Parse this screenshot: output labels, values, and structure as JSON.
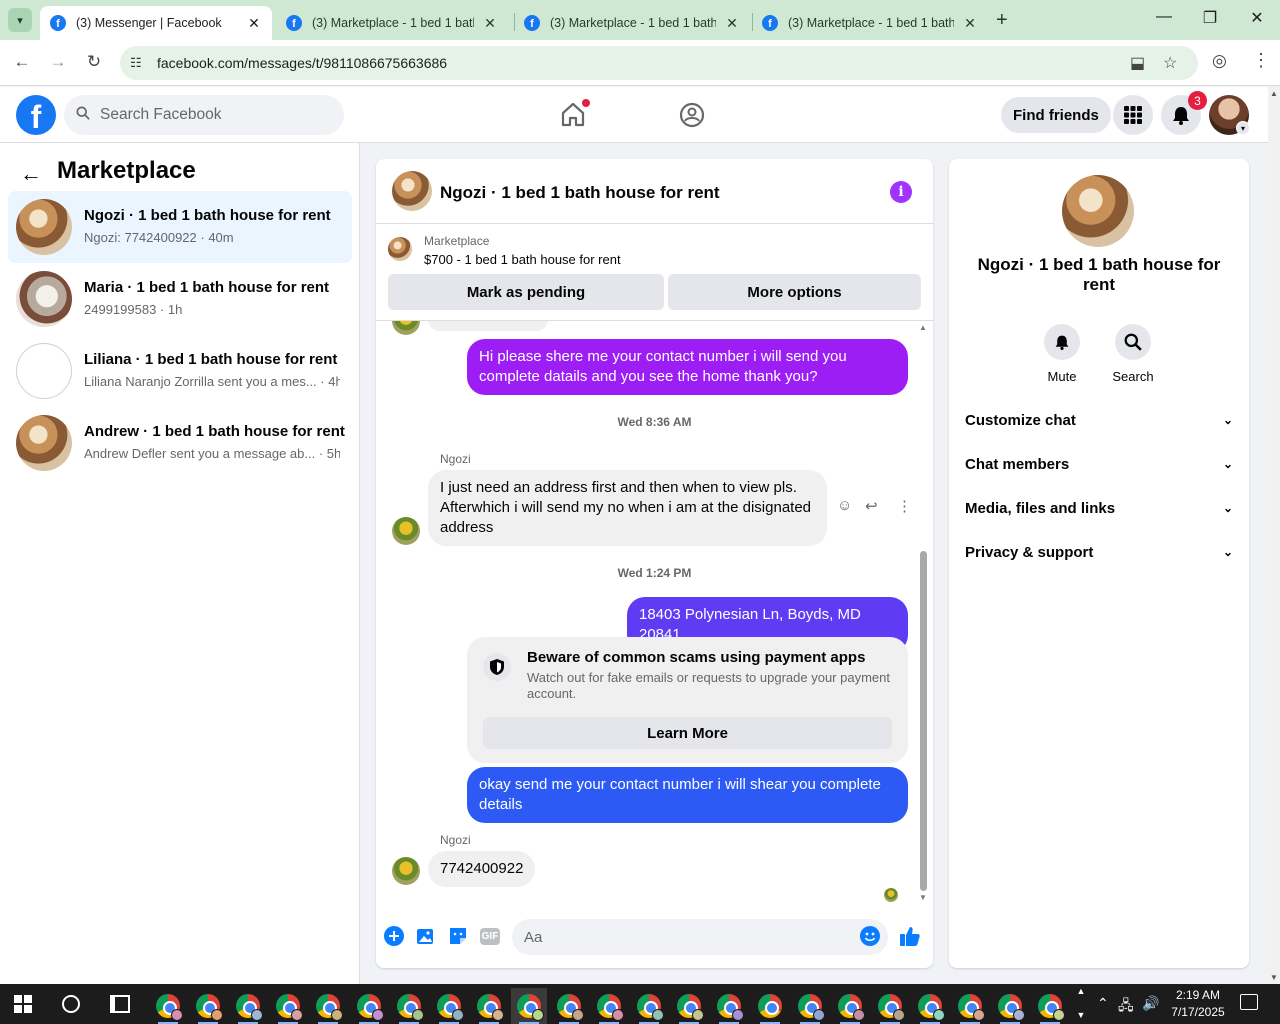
{
  "browser": {
    "tabs": [
      {
        "title": "(3) Messenger | Facebook",
        "active": true
      },
      {
        "title": "(3) Marketplace - 1 bed 1 bath",
        "active": false
      },
      {
        "title": "(3) Marketplace - 1 bed 1 bath",
        "active": false
      },
      {
        "title": "(3) Marketplace - 1 bed 1 bath",
        "active": false
      }
    ],
    "url": "facebook.com/messages/t/9811086675663686"
  },
  "fb_header": {
    "search_placeholder": "Search Facebook",
    "find_friends": "Find friends",
    "notification_count": "3"
  },
  "sidebar": {
    "title": "Marketplace",
    "conversations": [
      {
        "name": "Ngozi · 1 bed 1 bath house for rent",
        "preview": "Ngozi: 7742400922 · 40m",
        "selected": true
      },
      {
        "name": "Maria · 1 bed 1 bath house for rent",
        "preview": "2499199583 · 1h",
        "selected": false
      },
      {
        "name": "Liliana · 1 bed 1 bath house for rent",
        "preview": "Liliana Naranjo Zorrilla sent you a mes... · 4h",
        "selected": false
      },
      {
        "name": "Andrew · 1 bed 1 bath house for rent",
        "preview": "Andrew Defler sent you a message ab... · 5h",
        "selected": false
      }
    ]
  },
  "chat": {
    "title": "Ngozi · 1 bed 1 bath house for rent",
    "marketplace_label": "Marketplace",
    "listing": "$700 - 1 bed 1 bath house for rent",
    "mark_pending": "Mark as pending",
    "more_options": "More options",
    "messages": {
      "m1": "Hi please shere me your contact number i will send you complete datails and you see the home thank you?",
      "ts1": "Wed 8:36 AM",
      "sender1": "Ngozi",
      "m2": "I just need an address first and then when to view pls. Afterwhich i will send my no when i am at the disignated address",
      "ts2": "Wed 1:24 PM",
      "m3": "18403 Polynesian Ln, Boyds, MD 20841",
      "scam_title": "Beware of common scams using payment apps",
      "scam_desc": "Watch out for fake emails or requests to upgrade your payment account.",
      "learn_more": "Learn More",
      "m4": "okay send me your contact number i will shear you complete details",
      "sender2": "Ngozi",
      "m5": "7742400922"
    },
    "composer_placeholder": "Aa",
    "gif": "GIF"
  },
  "right_panel": {
    "name": "Ngozi · 1 bed 1 bath house for rent",
    "mute": "Mute",
    "search": "Search",
    "sections": [
      "Customize chat",
      "Chat members",
      "Media, files and links",
      "Privacy & support"
    ]
  },
  "taskbar": {
    "time": "2:19 AM",
    "date": "7/17/2025"
  }
}
